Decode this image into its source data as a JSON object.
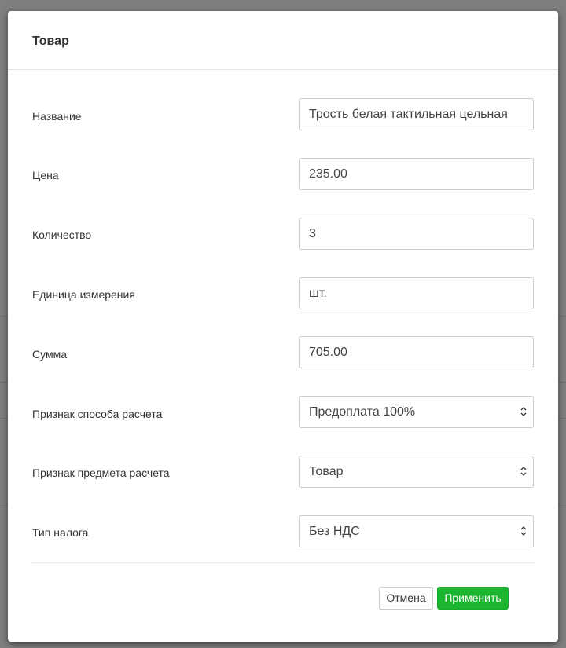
{
  "modal": {
    "title": "Товар",
    "fields": [
      {
        "label": "Название",
        "value": "Трость белая тактильная цельная",
        "kind": "input"
      },
      {
        "label": "Цена",
        "value": "235.00",
        "kind": "input"
      },
      {
        "label": "Количество",
        "value": "3",
        "kind": "input"
      },
      {
        "label": "Единица измерения",
        "value": "шт.",
        "kind": "input"
      },
      {
        "label": "Сумма",
        "value": "705.00",
        "kind": "input"
      },
      {
        "label": "Признак способа расчета",
        "value": "Предоплата 100%",
        "kind": "select"
      },
      {
        "label": "Признак предмета расчета",
        "value": "Товар",
        "kind": "select"
      },
      {
        "label": "Тип налога",
        "value": "Без НДС",
        "kind": "select"
      }
    ],
    "buttons": {
      "cancel_label": "Отмена",
      "apply_label": "Применить"
    }
  },
  "colors": {
    "overlay": "rgba(0,0,0,0.5)",
    "apply_button": "#1cb52f",
    "border": "#cccccc"
  },
  "icons": {
    "select_arrow": "chevron-up-down-icon"
  }
}
